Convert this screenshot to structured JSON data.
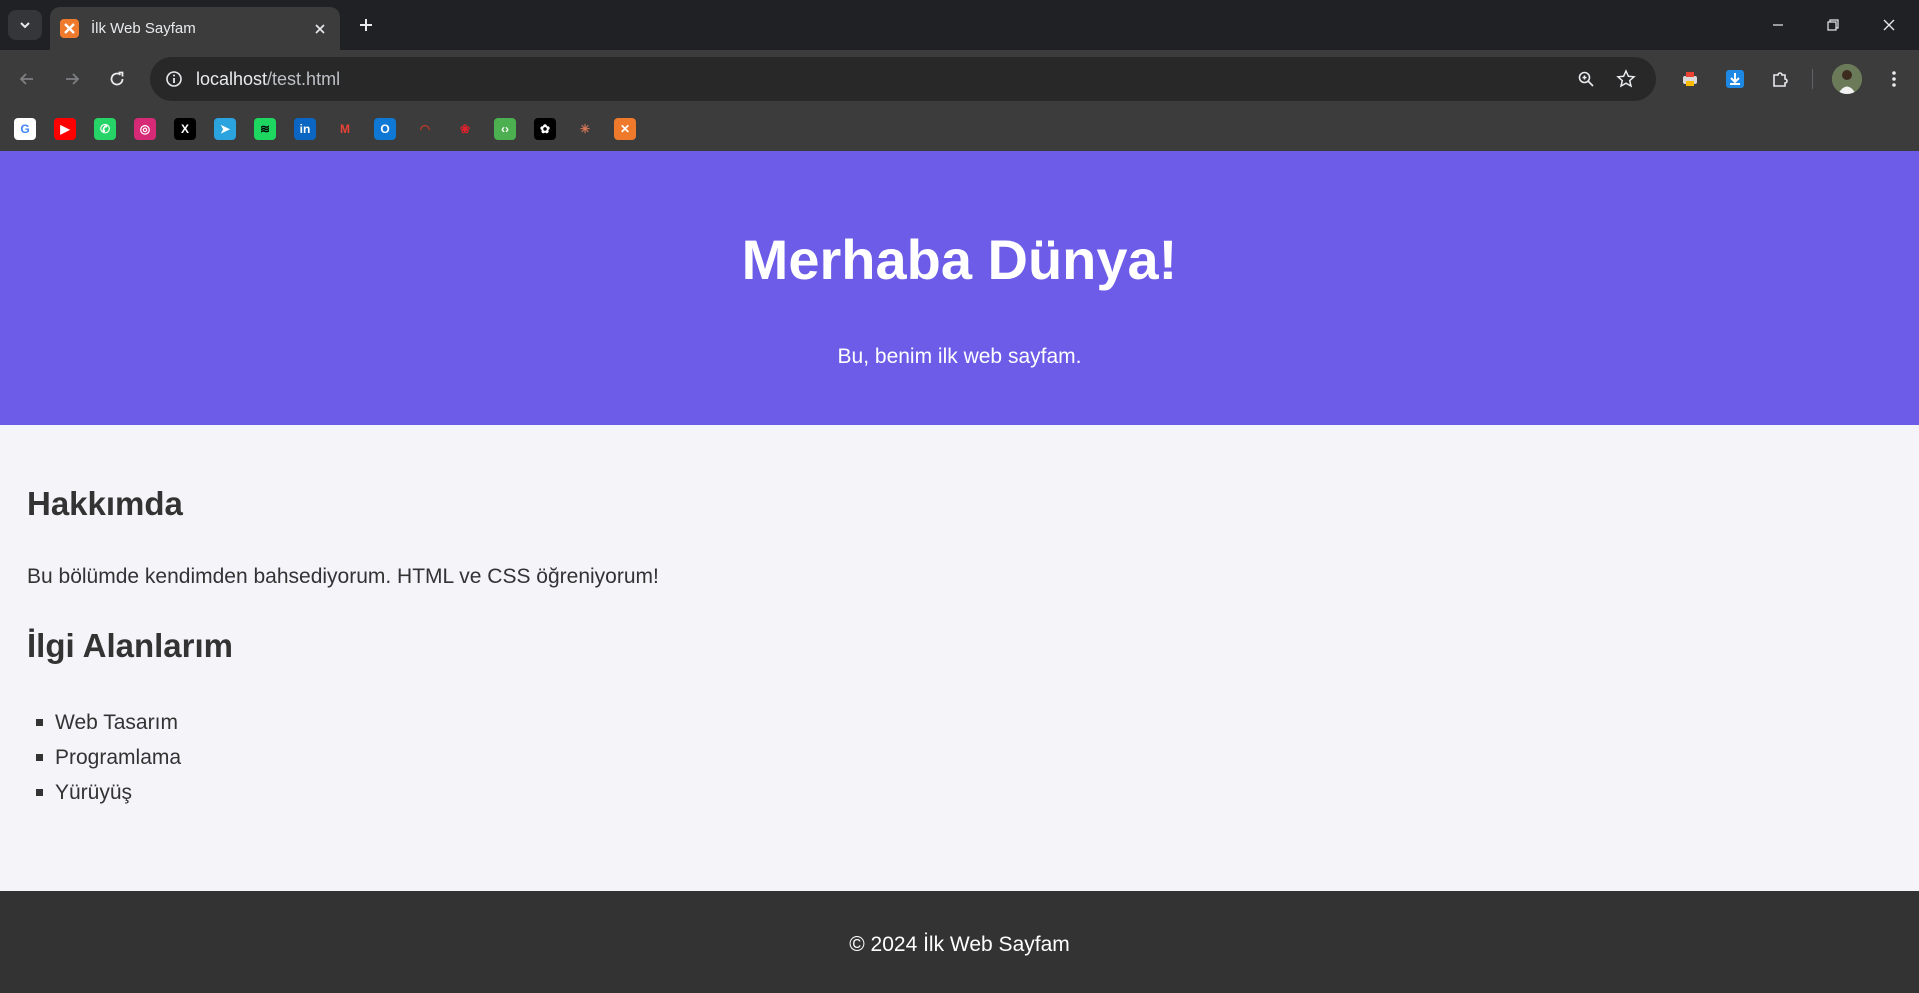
{
  "browser": {
    "tab_title": "İlk Web Sayfam",
    "url_host": "localhost",
    "url_path": "/test.html",
    "bookmarks": [
      {
        "icon": "google-icon",
        "glyph": "G",
        "color": "#ffffff",
        "fg": "#4285f4"
      },
      {
        "icon": "youtube-icon",
        "glyph": "▶",
        "color": "#ff0000",
        "fg": "#ffffff"
      },
      {
        "icon": "whatsapp-icon",
        "glyph": "✆",
        "color": "#25d366",
        "fg": "#ffffff"
      },
      {
        "icon": "instagram-icon",
        "glyph": "◎",
        "color": "#d62976",
        "fg": "#ffffff"
      },
      {
        "icon": "x-icon",
        "glyph": "X",
        "color": "#000000",
        "fg": "#ffffff"
      },
      {
        "icon": "telegram-icon",
        "glyph": "➤",
        "color": "#2aa3df",
        "fg": "#ffffff"
      },
      {
        "icon": "spotify-icon",
        "glyph": "≋",
        "color": "#1ed760",
        "fg": "#000000"
      },
      {
        "icon": "linkedin-icon",
        "glyph": "in",
        "color": "#0a66c2",
        "fg": "#ffffff"
      },
      {
        "icon": "gmail-icon",
        "glyph": "M",
        "color": "#3c3c3c",
        "fg": "#ea4335"
      },
      {
        "icon": "outlook-icon",
        "glyph": "O",
        "color": "#0f78d4",
        "fg": "#ffffff"
      },
      {
        "icon": "speedtest-icon",
        "glyph": "◠",
        "color": "#3c3c3c",
        "fg": "#c0392b"
      },
      {
        "icon": "huawei-icon",
        "glyph": "❀",
        "color": "#3c3c3c",
        "fg": "#e3202b"
      },
      {
        "icon": "code-icon",
        "glyph": "‹›",
        "color": "#4caf50",
        "fg": "#ffffff"
      },
      {
        "icon": "openai-icon",
        "glyph": "✿",
        "color": "#000000",
        "fg": "#ffffff"
      },
      {
        "icon": "claude-icon",
        "glyph": "✳",
        "color": "#3c3c3c",
        "fg": "#d97757"
      },
      {
        "icon": "xampp-icon",
        "glyph": "✕",
        "color": "#f07a2c",
        "fg": "#ffffff"
      }
    ]
  },
  "hero": {
    "title": "Merhaba Dünya!",
    "subtitle": "Bu, benim ilk web sayfam."
  },
  "about": {
    "title": "Hakkımda",
    "text": "Bu bölümde kendimden bahsediyorum. HTML ve CSS öğreniyorum!"
  },
  "interests": {
    "title": "İlgi Alanlarım",
    "items": [
      "Web Tasarım",
      "Programlama",
      "Yürüyüş"
    ]
  },
  "footer": {
    "text": "© 2024 İlk Web Sayfam"
  },
  "colors": {
    "hero_bg": "#6c5ce7",
    "footer_bg": "#333333",
    "page_bg": "#f4f4f9"
  }
}
